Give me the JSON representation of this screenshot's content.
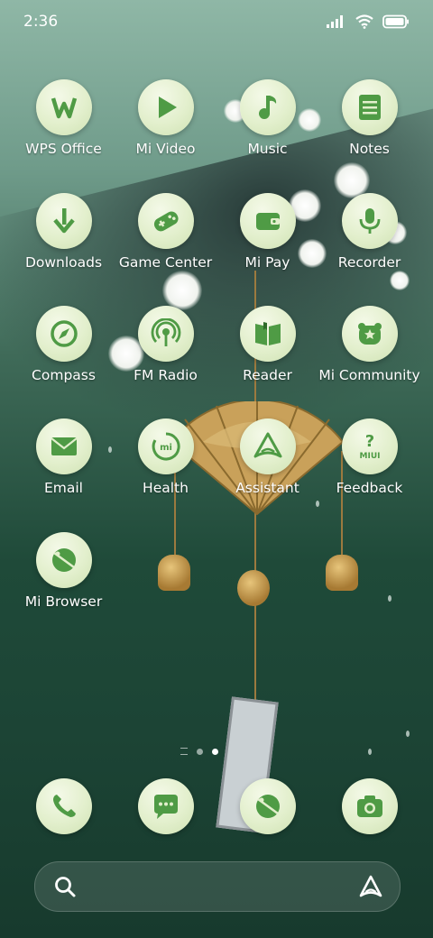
{
  "status_bar": {
    "time": "2:36"
  },
  "apps": [
    {
      "label": "WPS Office",
      "icon": "wps-office-icon"
    },
    {
      "label": "Mi Video",
      "icon": "play-icon"
    },
    {
      "label": "Music",
      "icon": "music-note-icon"
    },
    {
      "label": "Notes",
      "icon": "notes-icon"
    },
    {
      "label": "Downloads",
      "icon": "download-arrow-icon"
    },
    {
      "label": "Game Center",
      "icon": "gamepad-icon"
    },
    {
      "label": "Mi Pay",
      "icon": "wallet-icon"
    },
    {
      "label": "Recorder",
      "icon": "microphone-icon"
    },
    {
      "label": "Compass",
      "icon": "compass-icon"
    },
    {
      "label": "FM Radio",
      "icon": "radio-icon"
    },
    {
      "label": "Reader",
      "icon": "book-icon"
    },
    {
      "label": "Mi Community",
      "icon": "community-icon"
    },
    {
      "label": "Email",
      "icon": "envelope-icon"
    },
    {
      "label": "Health",
      "icon": "health-ring-icon"
    },
    {
      "label": "Assistant",
      "icon": "assistant-icon"
    },
    {
      "label": "Feedback",
      "icon": "feedback-icon"
    },
    {
      "label": "Mi Browser",
      "icon": "browser-icon"
    }
  ],
  "dock": [
    {
      "icon": "phone-icon"
    },
    {
      "icon": "messages-icon"
    },
    {
      "icon": "browser-icon"
    },
    {
      "icon": "camera-icon"
    }
  ],
  "colors": {
    "icon_glyph": "#4f9b45",
    "icon_bg": "#e2efcc"
  }
}
